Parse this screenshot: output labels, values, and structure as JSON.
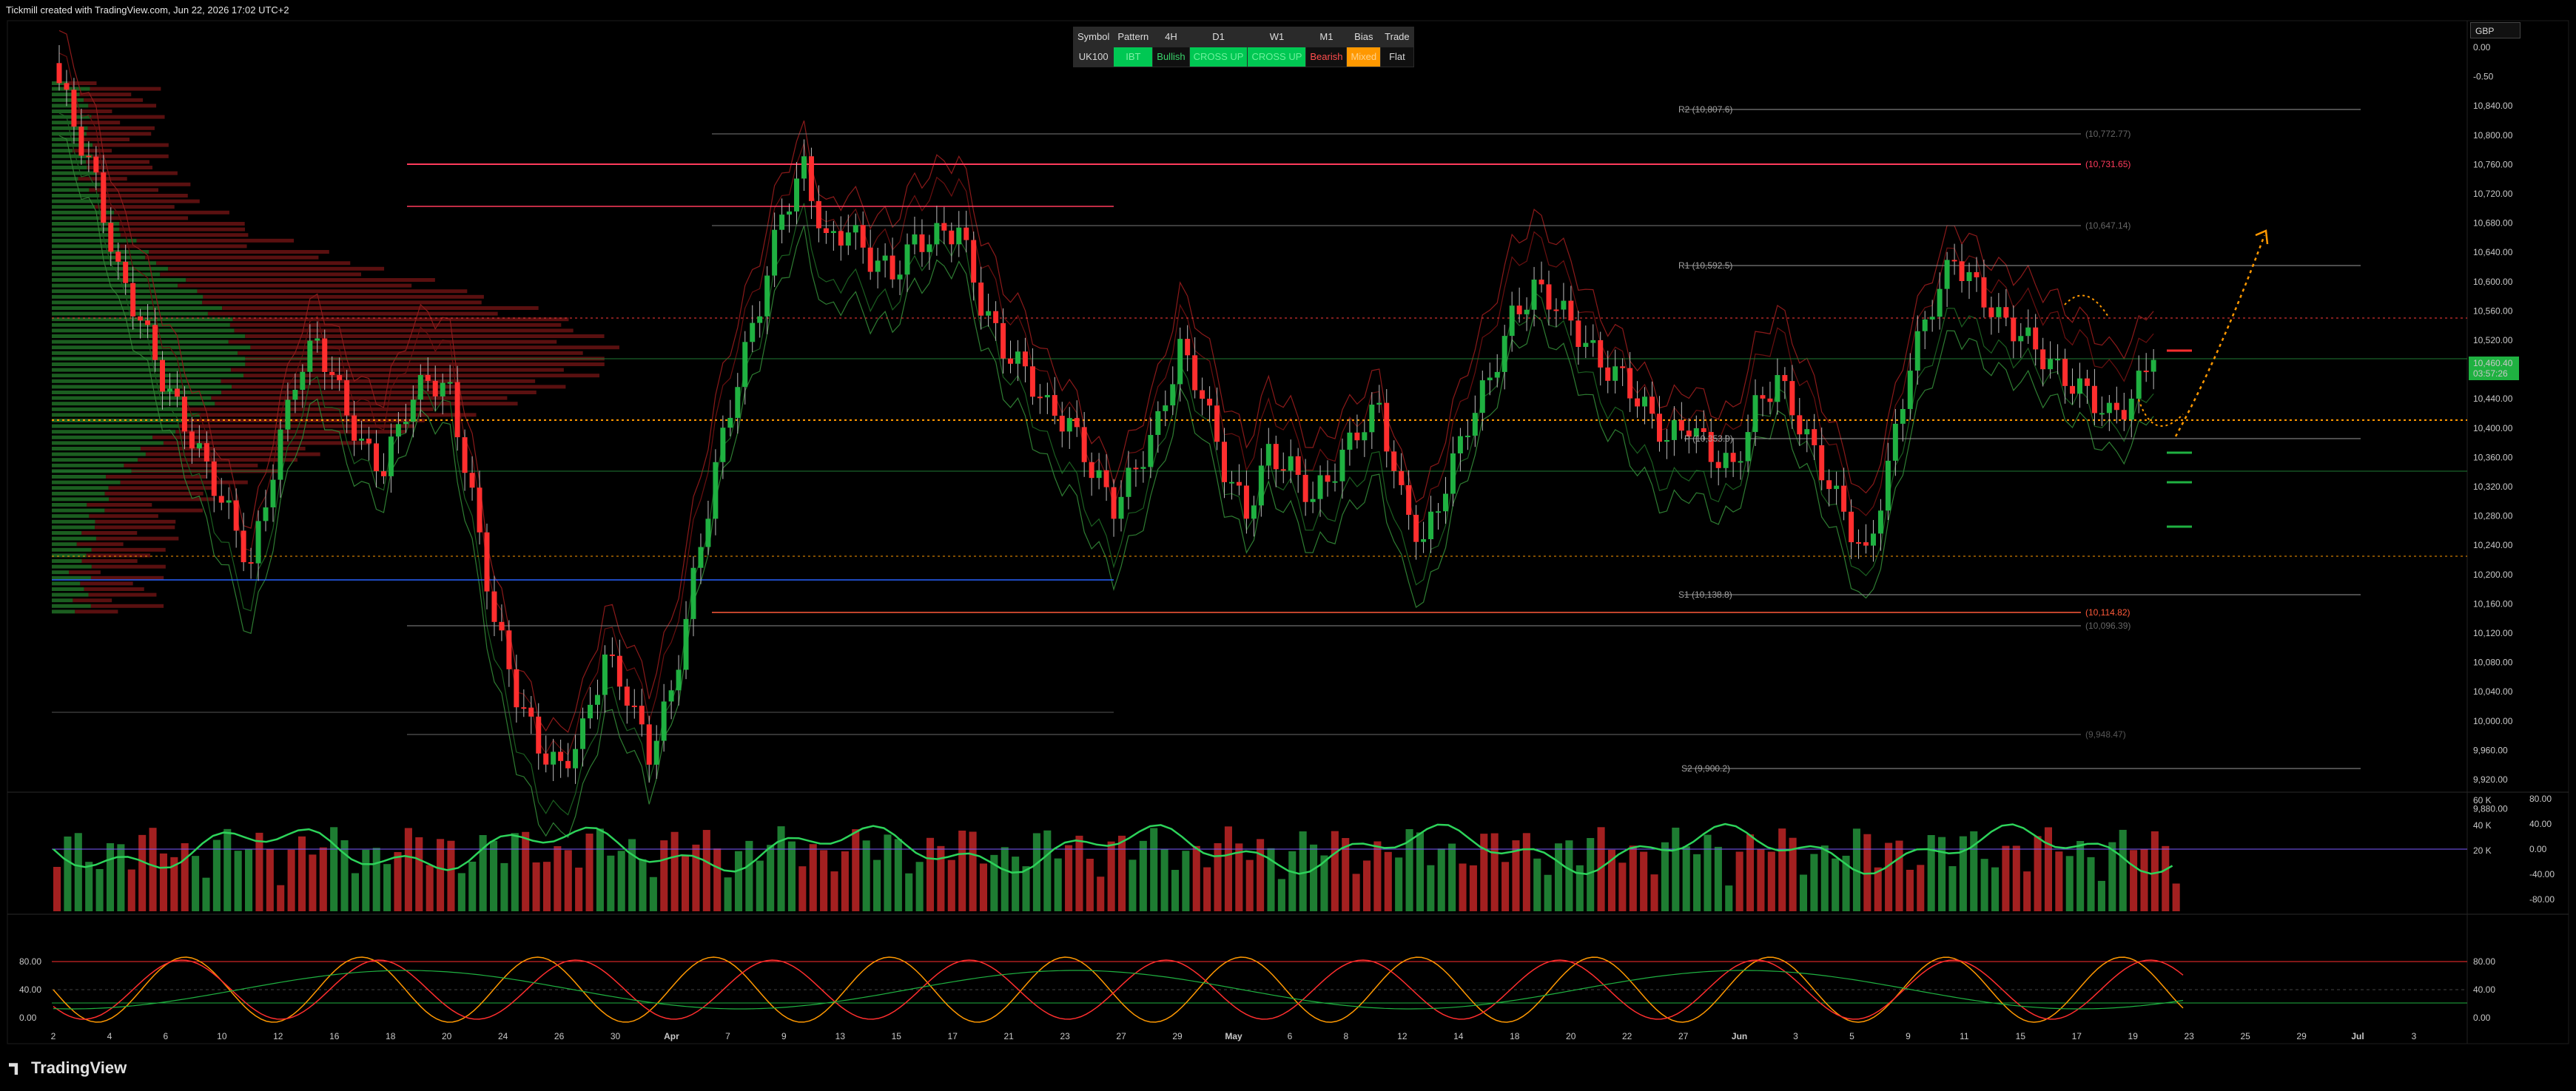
{
  "header": {
    "text": "Tickmill created with TradingView.com, Jun 22, 2026 17:02 UTC+2"
  },
  "currency": "GBP",
  "signal_table": {
    "headers": [
      "Symbol",
      "Pattern",
      "4H",
      "D1",
      "W1",
      "M1",
      "Bias",
      "Trade"
    ],
    "row": [
      {
        "text": "UK100",
        "bg": "#2a2a2a",
        "fg": "#d6d6d6"
      },
      {
        "text": "IBT",
        "bg": "#00c853",
        "fg": "#7ff0a6"
      },
      {
        "text": "Bullish",
        "bg": "#101010",
        "fg": "#39d36a"
      },
      {
        "text": "CROSS UP",
        "bg": "#00c853",
        "fg": "#6df19b"
      },
      {
        "text": "CROSS UP",
        "bg": "#00c853",
        "fg": "#6df19b"
      },
      {
        "text": "Bearish",
        "bg": "#101010",
        "fg": "#ff4d4d"
      },
      {
        "text": "Mixed",
        "bg": "#ff9800",
        "fg": "#ffd28a"
      },
      {
        "text": "Flat",
        "bg": "#101010",
        "fg": "#d6d6d6"
      }
    ]
  },
  "price_axis": {
    "ticks": [
      "0.00",
      "-0.50",
      "10,840.00",
      "10,800.00",
      "10,760.00",
      "10,720.00",
      "10,680.00",
      "10,640.00",
      "10,600.00",
      "10,560.00",
      "10,520.00",
      "10,480.00",
      "10,440.00",
      "10,400.00",
      "10,360.00",
      "10,320.00",
      "10,280.00",
      "10,240.00",
      "10,200.00",
      "10,160.00",
      "10,120.00",
      "10,080.00",
      "10,040.00",
      "10,000.00",
      "9,960.00",
      "9,920.00",
      "9,880.00"
    ],
    "last_price": "10,460.40",
    "countdown": "03:57:26"
  },
  "levels": {
    "R2": "R2 (10,807.6)",
    "R1": "R1 (10,592.5)",
    "P": "P (10,353.9)",
    "S1": "S1 (10,138.8)",
    "S2": "S2 (9,900.2)",
    "fib_a": "(10,772.77)",
    "fib_b": "(10,731.65)",
    "fib_c": "(10,647.14)",
    "fib_d": "(10,114.82)",
    "fib_e": "(10,096.39)",
    "fib_f": "(9,948.47)"
  },
  "volume_axis": {
    "left_ticks": [
      "60 K",
      "40 K",
      "20 K"
    ],
    "right_ticks": [
      "80.00",
      "40.00",
      "0.00",
      "-40.00",
      "-80.00"
    ]
  },
  "osc_axis": {
    "ticks": [
      "80.00",
      "40.00",
      "0.00"
    ]
  },
  "time_axis": {
    "ticks": [
      "2",
      "4",
      "6",
      "10",
      "12",
      "16",
      "18",
      "20",
      "24",
      "26",
      "30",
      "Apr",
      "7",
      "9",
      "13",
      "15",
      "17",
      "21",
      "23",
      "27",
      "29",
      "May",
      "6",
      "8",
      "12",
      "14",
      "18",
      "20",
      "22",
      "27",
      "Jun",
      "3",
      "5",
      "9",
      "11",
      "15",
      "17",
      "19",
      "23",
      "25",
      "29",
      "Jul",
      "3"
    ]
  },
  "brand": "TradingView",
  "colors": {
    "bull": "#26a69a",
    "green": "#1fb141",
    "red": "#ff2e2e",
    "orange": "#ff9800",
    "blue": "#2962ff"
  },
  "chart_data": {
    "type": "candlestick",
    "symbol": "UK100",
    "ylim": [
      9880,
      10860
    ],
    "pivots": {
      "R2": 10807.6,
      "R1": 10592.5,
      "P": 10353.9,
      "S1": 10138.8,
      "S2": 9900.2
    },
    "closes": [
      10840,
      10760,
      10680,
      10560,
      10500,
      10420,
      10360,
      10300,
      10240,
      10170,
      10300,
      10420,
      10470,
      10400,
      10330,
      10300,
      10380,
      10420,
      10400,
      10260,
      10100,
      10000,
      9930,
      9900,
      9950,
      10050,
      10000,
      9920,
      10000,
      10150,
      10300,
      10420,
      10520,
      10640,
      10700,
      10600,
      10620,
      10580,
      10560,
      10600,
      10610,
      10620,
      10520,
      10460,
      10430,
      10380,
      10360,
      10300,
      10250,
      10300,
      10360,
      10460,
      10400,
      10300,
      10240,
      10320,
      10300,
      10260,
      10300,
      10350,
      10380,
      10260,
      10200,
      10280,
      10360,
      10420,
      10500,
      10540,
      10520,
      10480,
      10440,
      10420,
      10380,
      10340,
      10360,
      10320,
      10300,
      10380,
      10420,
      10360,
      10300,
      10240,
      10180,
      10300,
      10440,
      10520,
      10580,
      10540,
      10500,
      10480,
      10450,
      10420,
      10400,
      10370,
      10390,
      10460
    ]
  }
}
